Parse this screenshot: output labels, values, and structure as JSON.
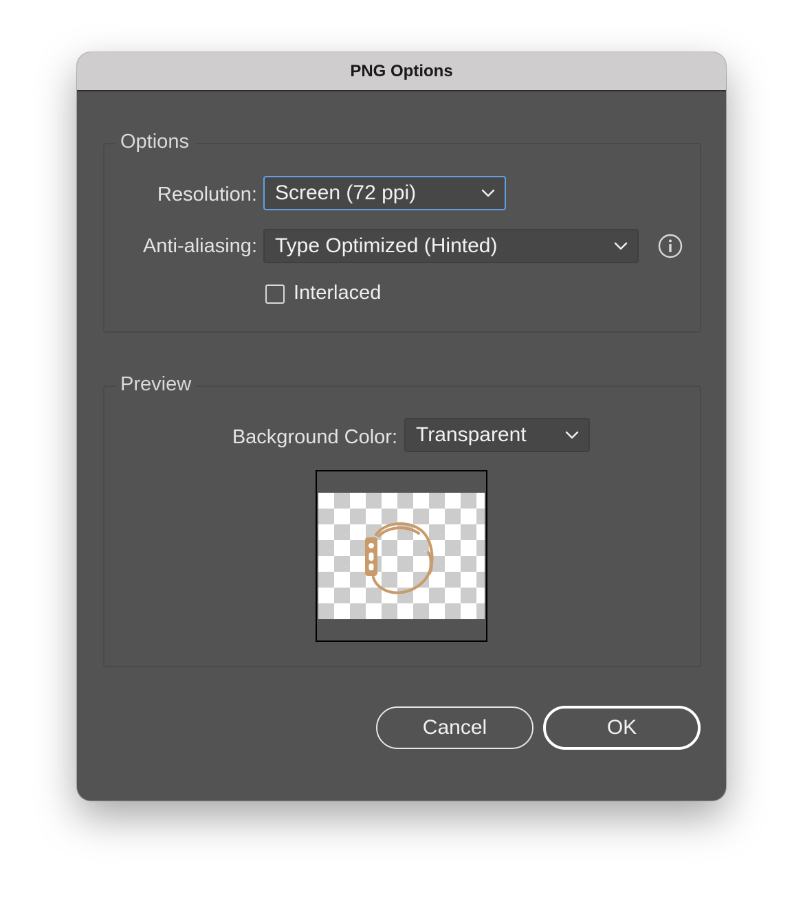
{
  "window": {
    "title": "PNG Options"
  },
  "options_group": {
    "title": "Options",
    "resolution": {
      "label": "Resolution:",
      "value": "Screen (72 ppi)"
    },
    "anti_aliasing": {
      "label": "Anti-aliasing:",
      "value": "Type Optimized (Hinted)"
    },
    "interlaced": {
      "label": "Interlaced",
      "checked": false
    }
  },
  "preview_group": {
    "title": "Preview",
    "background_color": {
      "label": "Background Color:",
      "value": "Transparent"
    }
  },
  "buttons": {
    "cancel": "Cancel",
    "ok": "OK"
  },
  "colors": {
    "accent": "#62a0e6",
    "watch_icon": "#c99a6a",
    "dialog_bg": "#535353"
  },
  "icons": {
    "info": "info-circle-icon",
    "dropdown": "chevron-down-icon",
    "watch": "smartwatch-icon"
  }
}
